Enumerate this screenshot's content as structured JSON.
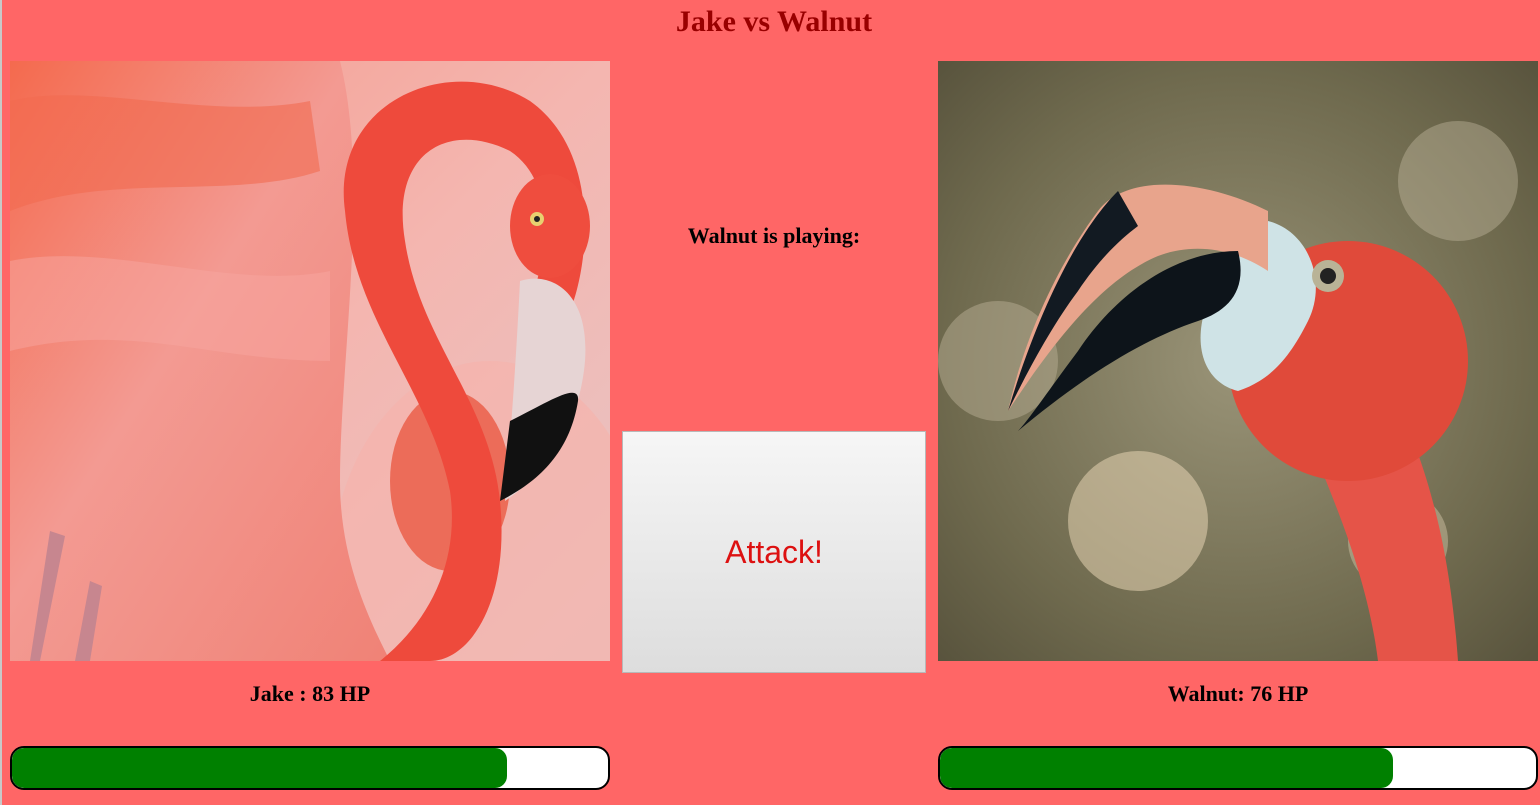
{
  "title": "Jake vs Walnut",
  "status": "Walnut is playing:",
  "attack_label": "Attack!",
  "players": [
    {
      "name": "Jake",
      "hp_text": "Jake : 83 HP",
      "hp": 83,
      "max_hp": 100
    },
    {
      "name": "Walnut",
      "hp_text": "Walnut: 76 HP",
      "hp": 76,
      "max_hp": 100
    }
  ],
  "colors": {
    "background": "#ff6666",
    "title": "#990000",
    "attack_text": "#dd1111",
    "hp_fill": "#008000",
    "hp_track": "#ffffff"
  }
}
